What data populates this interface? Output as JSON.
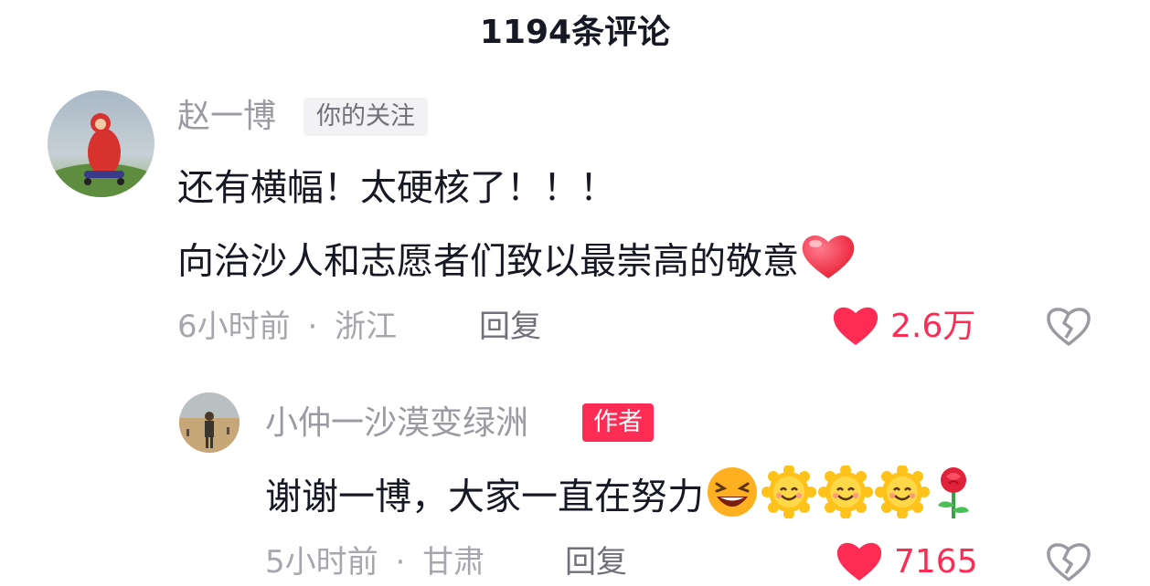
{
  "header": {
    "title": "1194条评论"
  },
  "comments": [
    {
      "username": "赵一博",
      "badge": "你的关注",
      "lines": [
        "还有横幅！太硬核了！！！",
        "向治沙人和志愿者们致以最崇高的敬意"
      ],
      "time": "6小时前",
      "separator": "·",
      "location": "浙江",
      "reply_label": "回复",
      "likes": "2.6万",
      "emoji_names": [
        "red-heart-emoji"
      ],
      "reply": {
        "username": "小仲一沙漠变绿洲",
        "badge": "作者",
        "text": "谢谢一博，大家一直在努力",
        "emoji_names": [
          "laughing-emoji",
          "smiling-sun-emoji",
          "smiling-sun-emoji",
          "smiling-sun-emoji",
          "rose-emoji"
        ],
        "time": "5小时前",
        "separator": "·",
        "location": "甘肃",
        "reply_label": "回复",
        "likes": "7165"
      }
    }
  ],
  "colors": {
    "accent": "#fe2c55",
    "muted": "#a6a7ad",
    "text": "#161823"
  },
  "icons": [
    "liked-heart-icon",
    "broken-heart-icon"
  ]
}
